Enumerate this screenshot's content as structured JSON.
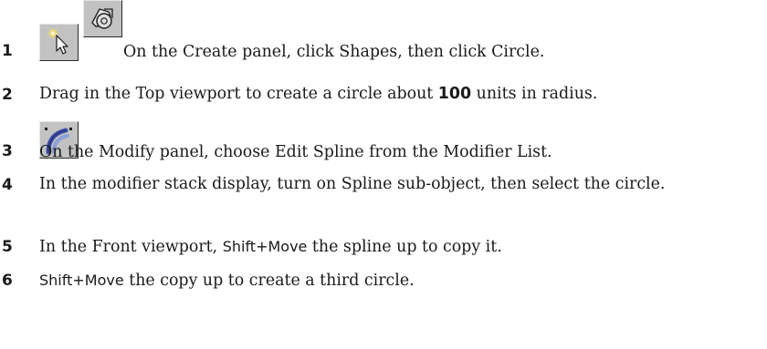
{
  "steps": [
    {
      "number": "1",
      "icons": [
        "select-arrow-icon",
        "shapes-icon"
      ],
      "text": "On the Create panel, click Shapes, then click Circle."
    },
    {
      "number": "2",
      "text_before": "Drag in the Top viewport to create a circle about ",
      "bold_value": "100",
      "text_after": " units in radius."
    },
    {
      "number": "3",
      "icons": [
        "modify-panel-icon"
      ],
      "text": "On the Modify panel, choose Edit Spline from the Modifier List."
    },
    {
      "number": "4",
      "text": "In the modifier stack display, turn on Spline sub-object, then select the circle."
    },
    {
      "number": "5",
      "text_before": "In the Front viewport, ",
      "sans_text": "Shift+Move",
      "text_after": " the spline up to copy it."
    },
    {
      "number": "6",
      "sans_text": "Shift+Move",
      "text_after": " the copy up to create a third circle."
    }
  ]
}
